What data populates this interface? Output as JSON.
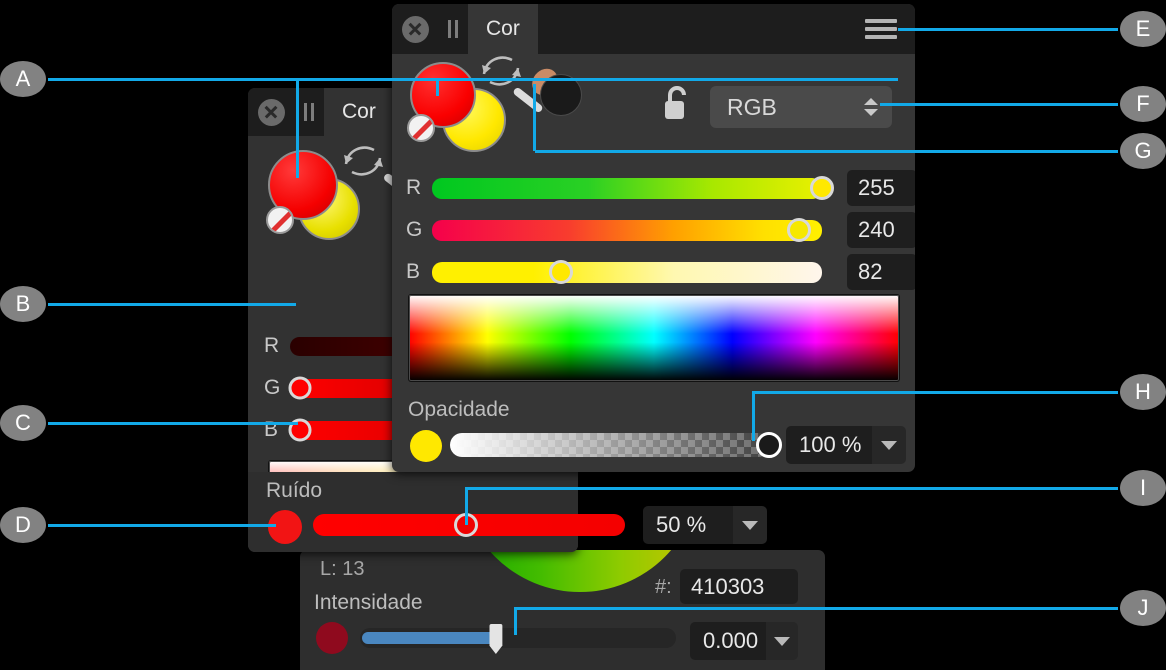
{
  "app": {
    "tab_label": "Cor",
    "close_icon": "close-circle-icon",
    "pause_icon": "pause-icon",
    "menu_icon": "hamburger-menu-icon",
    "lock_icon": "open-padlock-icon",
    "eyedropper_icon": "eyedropper-icon",
    "swap_icon": "swap-arrow-icon",
    "no_color_icon": "no-color-slash-icon"
  },
  "front_dialog": {
    "tab_label": "Cor",
    "color_model": "RGB",
    "foreground_color": "#FF0000",
    "background_color": "#FFE800",
    "picked_swatch_color": "#1a1a1a",
    "channels": [
      {
        "label": "R",
        "value": "255",
        "knob_pct": 100,
        "track_from": "#00c820",
        "track_to": "#eaf000"
      },
      {
        "label": "G",
        "value": "240",
        "knob_pct": 94,
        "track_from": "#f5004b",
        "track_to": "#fff000"
      },
      {
        "label": "B",
        "value": "82",
        "knob_pct": 33,
        "track_from": "#fff000",
        "track_to": "#fff6ec"
      }
    ],
    "opacity": {
      "label": "Opacidade",
      "value": "100 %",
      "knob_pct": 100,
      "swatch_color": "#FFE800"
    }
  },
  "back_dialog": {
    "tab_label": "Cor",
    "foreground_color": "#FF0000",
    "background_color": "#E8E000",
    "channels": [
      {
        "label": "R",
        "value": "",
        "knob_pct": -1,
        "track_from": "#2a0000",
        "track_to": "#550000"
      },
      {
        "label": "G",
        "value": "",
        "knob_pct": 0,
        "track_from": "#ff0000",
        "track_to": "#c00000"
      },
      {
        "label": "B",
        "value": "",
        "knob_pct": 0,
        "track_from": "#ff0000",
        "track_to": "#d00000"
      }
    ],
    "noise": {
      "label": "Ruído",
      "value": "50 %",
      "knob_pct": 50,
      "swatch_color": "#f21414"
    }
  },
  "bottom_panel": {
    "luminance_label": "L: 13",
    "hex_label": "#:",
    "hex_value": "410303",
    "intensity": {
      "label": "Intensidade",
      "value": "0.000",
      "knob_pct": 43,
      "swatch_color": "#8f0a1e",
      "fill_color": "#4a87c0"
    }
  },
  "callouts": {
    "accent": "#12a9e8",
    "left": [
      {
        "id": "A",
        "label": "A"
      },
      {
        "id": "B",
        "label": "B"
      },
      {
        "id": "C",
        "label": "C"
      },
      {
        "id": "D",
        "label": "D"
      }
    ],
    "right": [
      {
        "id": "E",
        "label": "E"
      },
      {
        "id": "F",
        "label": "F"
      },
      {
        "id": "G",
        "label": "G"
      },
      {
        "id": "H",
        "label": "H"
      },
      {
        "id": "I",
        "label": "I"
      },
      {
        "id": "J",
        "label": "J"
      }
    ]
  }
}
